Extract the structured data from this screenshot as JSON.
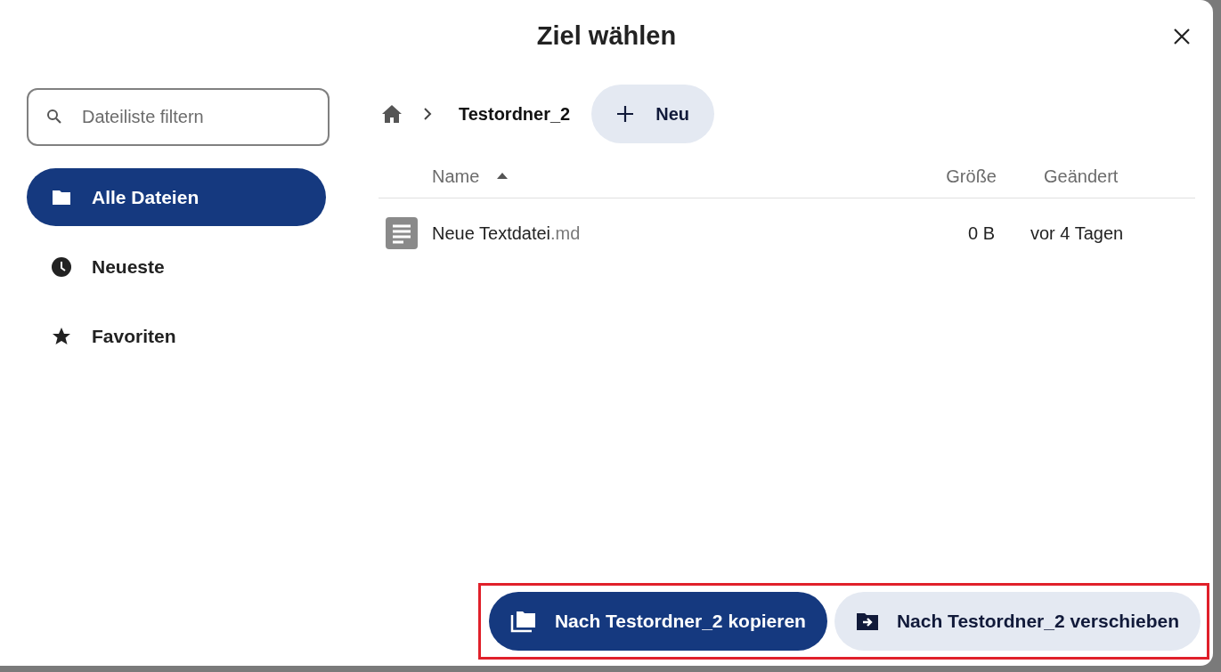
{
  "dialog": {
    "title": "Ziel wählen"
  },
  "search": {
    "placeholder": "Dateiliste filtern"
  },
  "sidebar": {
    "items": [
      {
        "label": "Alle Dateien",
        "kind": "folder",
        "selected": true
      },
      {
        "label": "Neueste",
        "kind": "clock",
        "selected": false
      },
      {
        "label": "Favoriten",
        "kind": "star",
        "selected": false
      }
    ]
  },
  "breadcrumb": {
    "current": "Testordner_2",
    "new_button": "Neu"
  },
  "table": {
    "columns": [
      {
        "label": "Name",
        "sorted_ascending": true
      },
      {
        "label": "Größe"
      },
      {
        "label": "Geändert"
      }
    ],
    "rows": [
      {
        "name": "Neue Textdatei",
        "extension": ".md",
        "size": "0 B",
        "modified": "vor 4 Tagen"
      }
    ]
  },
  "buttons": [
    {
      "label": "Nach Testordner_2 kopieren",
      "kind": "primary"
    },
    {
      "label": "Nach Testordner_2 verschieben",
      "kind": "secondary"
    }
  ]
}
